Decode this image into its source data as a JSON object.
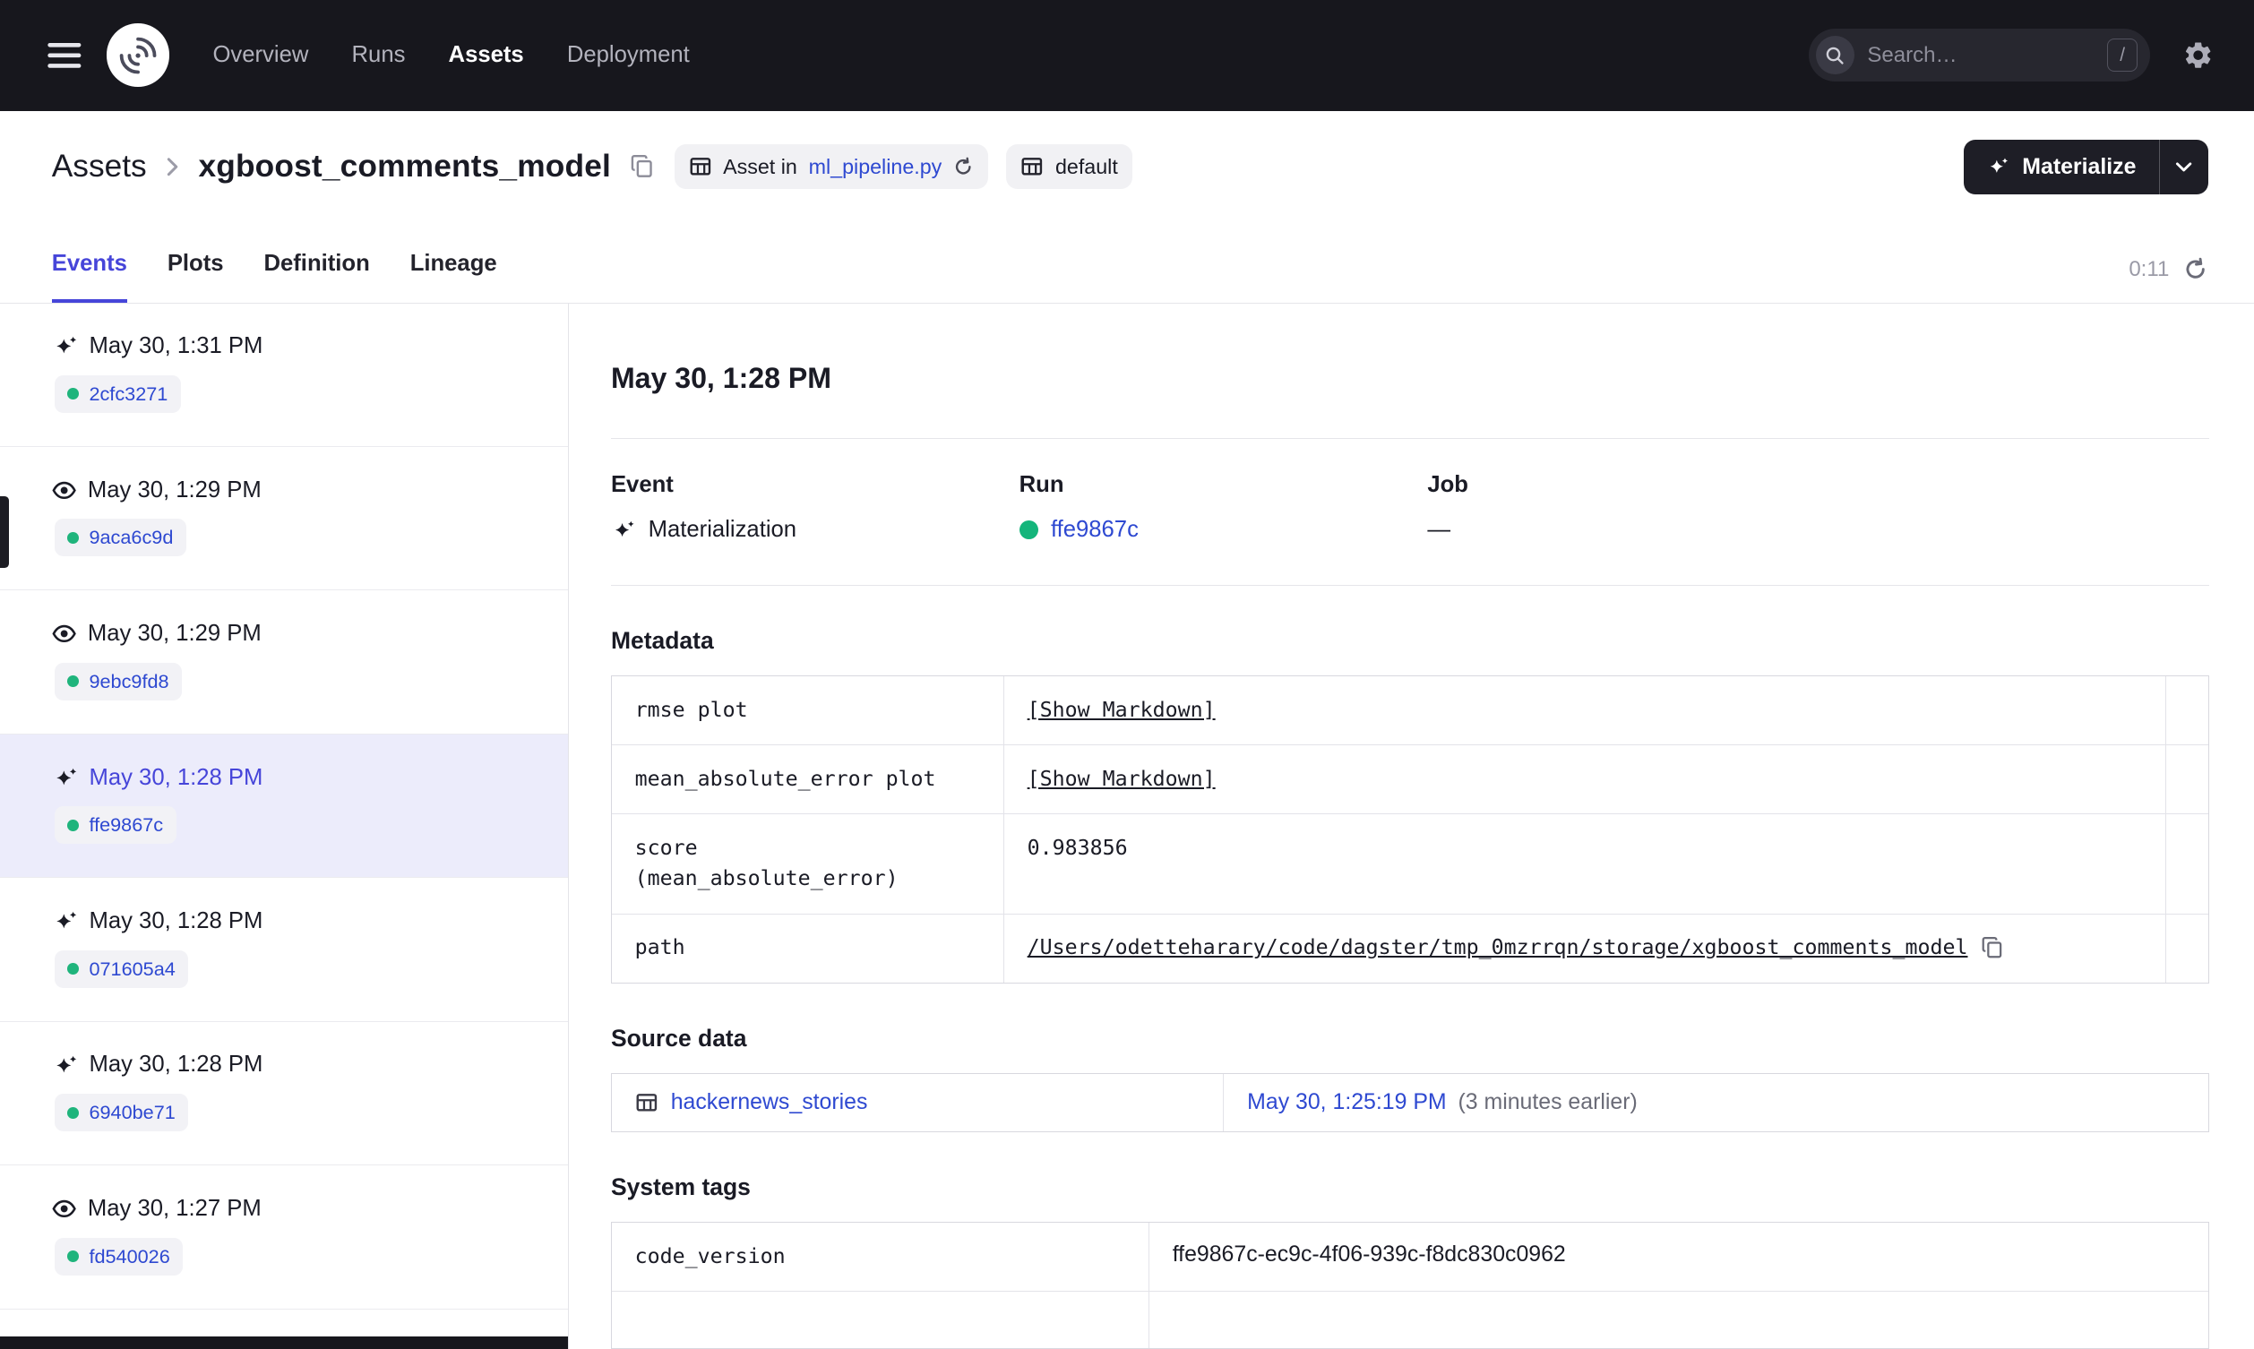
{
  "colors": {
    "nav_bg": "#17171D",
    "link_blue": "#2E49D1",
    "accent_indigo": "#4645D9",
    "status_green": "#1FB47C",
    "selected_row_bg": "#ECECFB",
    "text_primary": "#1A1B25",
    "text_secondary": "#6A6B77"
  },
  "topnav": {
    "nav": [
      {
        "label": "Overview"
      },
      {
        "label": "Runs"
      },
      {
        "label": "Assets"
      },
      {
        "label": "Deployment"
      }
    ],
    "search": {
      "placeholder": "Search…",
      "shortcut": "/"
    }
  },
  "header": {
    "breadcrumb_root": "Assets",
    "asset_name": "xgboost_comments_model",
    "code_location_tag": {
      "prefix": "Asset in",
      "file": "ml_pipeline.py"
    },
    "group_tag": "default",
    "materialize_label": "Materialize"
  },
  "tabs": [
    {
      "label": "Events"
    },
    {
      "label": "Plots"
    },
    {
      "label": "Definition"
    },
    {
      "label": "Lineage"
    }
  ],
  "refresh_timer": "0:11",
  "sidebar": {
    "events": [
      {
        "type": "materialization",
        "time": "May 30, 1:31 PM",
        "run_id": "2cfc3271"
      },
      {
        "type": "observation",
        "time": "May 30, 1:29 PM",
        "run_id": "9aca6c9d"
      },
      {
        "type": "observation",
        "time": "May 30, 1:29 PM",
        "run_id": "9ebc9fd8"
      },
      {
        "type": "materialization",
        "time": "May 30, 1:28 PM",
        "run_id": "ffe9867c",
        "selected": true
      },
      {
        "type": "materialization",
        "time": "May 30, 1:28 PM",
        "run_id": "071605a4"
      },
      {
        "type": "materialization",
        "time": "May 30, 1:28 PM",
        "run_id": "6940be71"
      },
      {
        "type": "observation",
        "time": "May 30, 1:27 PM",
        "run_id": "fd540026"
      }
    ]
  },
  "detail": {
    "title": "May 30, 1:28 PM",
    "columns": {
      "event_label": "Event",
      "event_value": "Materialization",
      "run_label": "Run",
      "run_value": "ffe9867c",
      "job_label": "Job",
      "job_value": "—"
    },
    "metadata": {
      "heading": "Metadata",
      "rows": [
        {
          "key": "rmse plot",
          "value": "[Show Markdown]"
        },
        {
          "key": "mean_absolute_error plot",
          "value": "[Show Markdown]"
        },
        {
          "key": "score\n(mean_absolute_error)",
          "value": "0.983856"
        },
        {
          "key": "path",
          "value": "/Users/odetteharary/code/dagster/tmp_0mzrrqn/storage/xgboost_comments_model"
        }
      ]
    },
    "source_data": {
      "heading": "Source data",
      "asset": "hackernews_stories",
      "timestamp": "May 30, 1:25:19 PM",
      "relative_time": "(3 minutes earlier)"
    },
    "system_tags": {
      "heading": "System tags",
      "rows": [
        {
          "key": "code_version",
          "value": "ffe9867c-ec9c-4f06-939c-f8dc830c0962"
        }
      ]
    }
  }
}
